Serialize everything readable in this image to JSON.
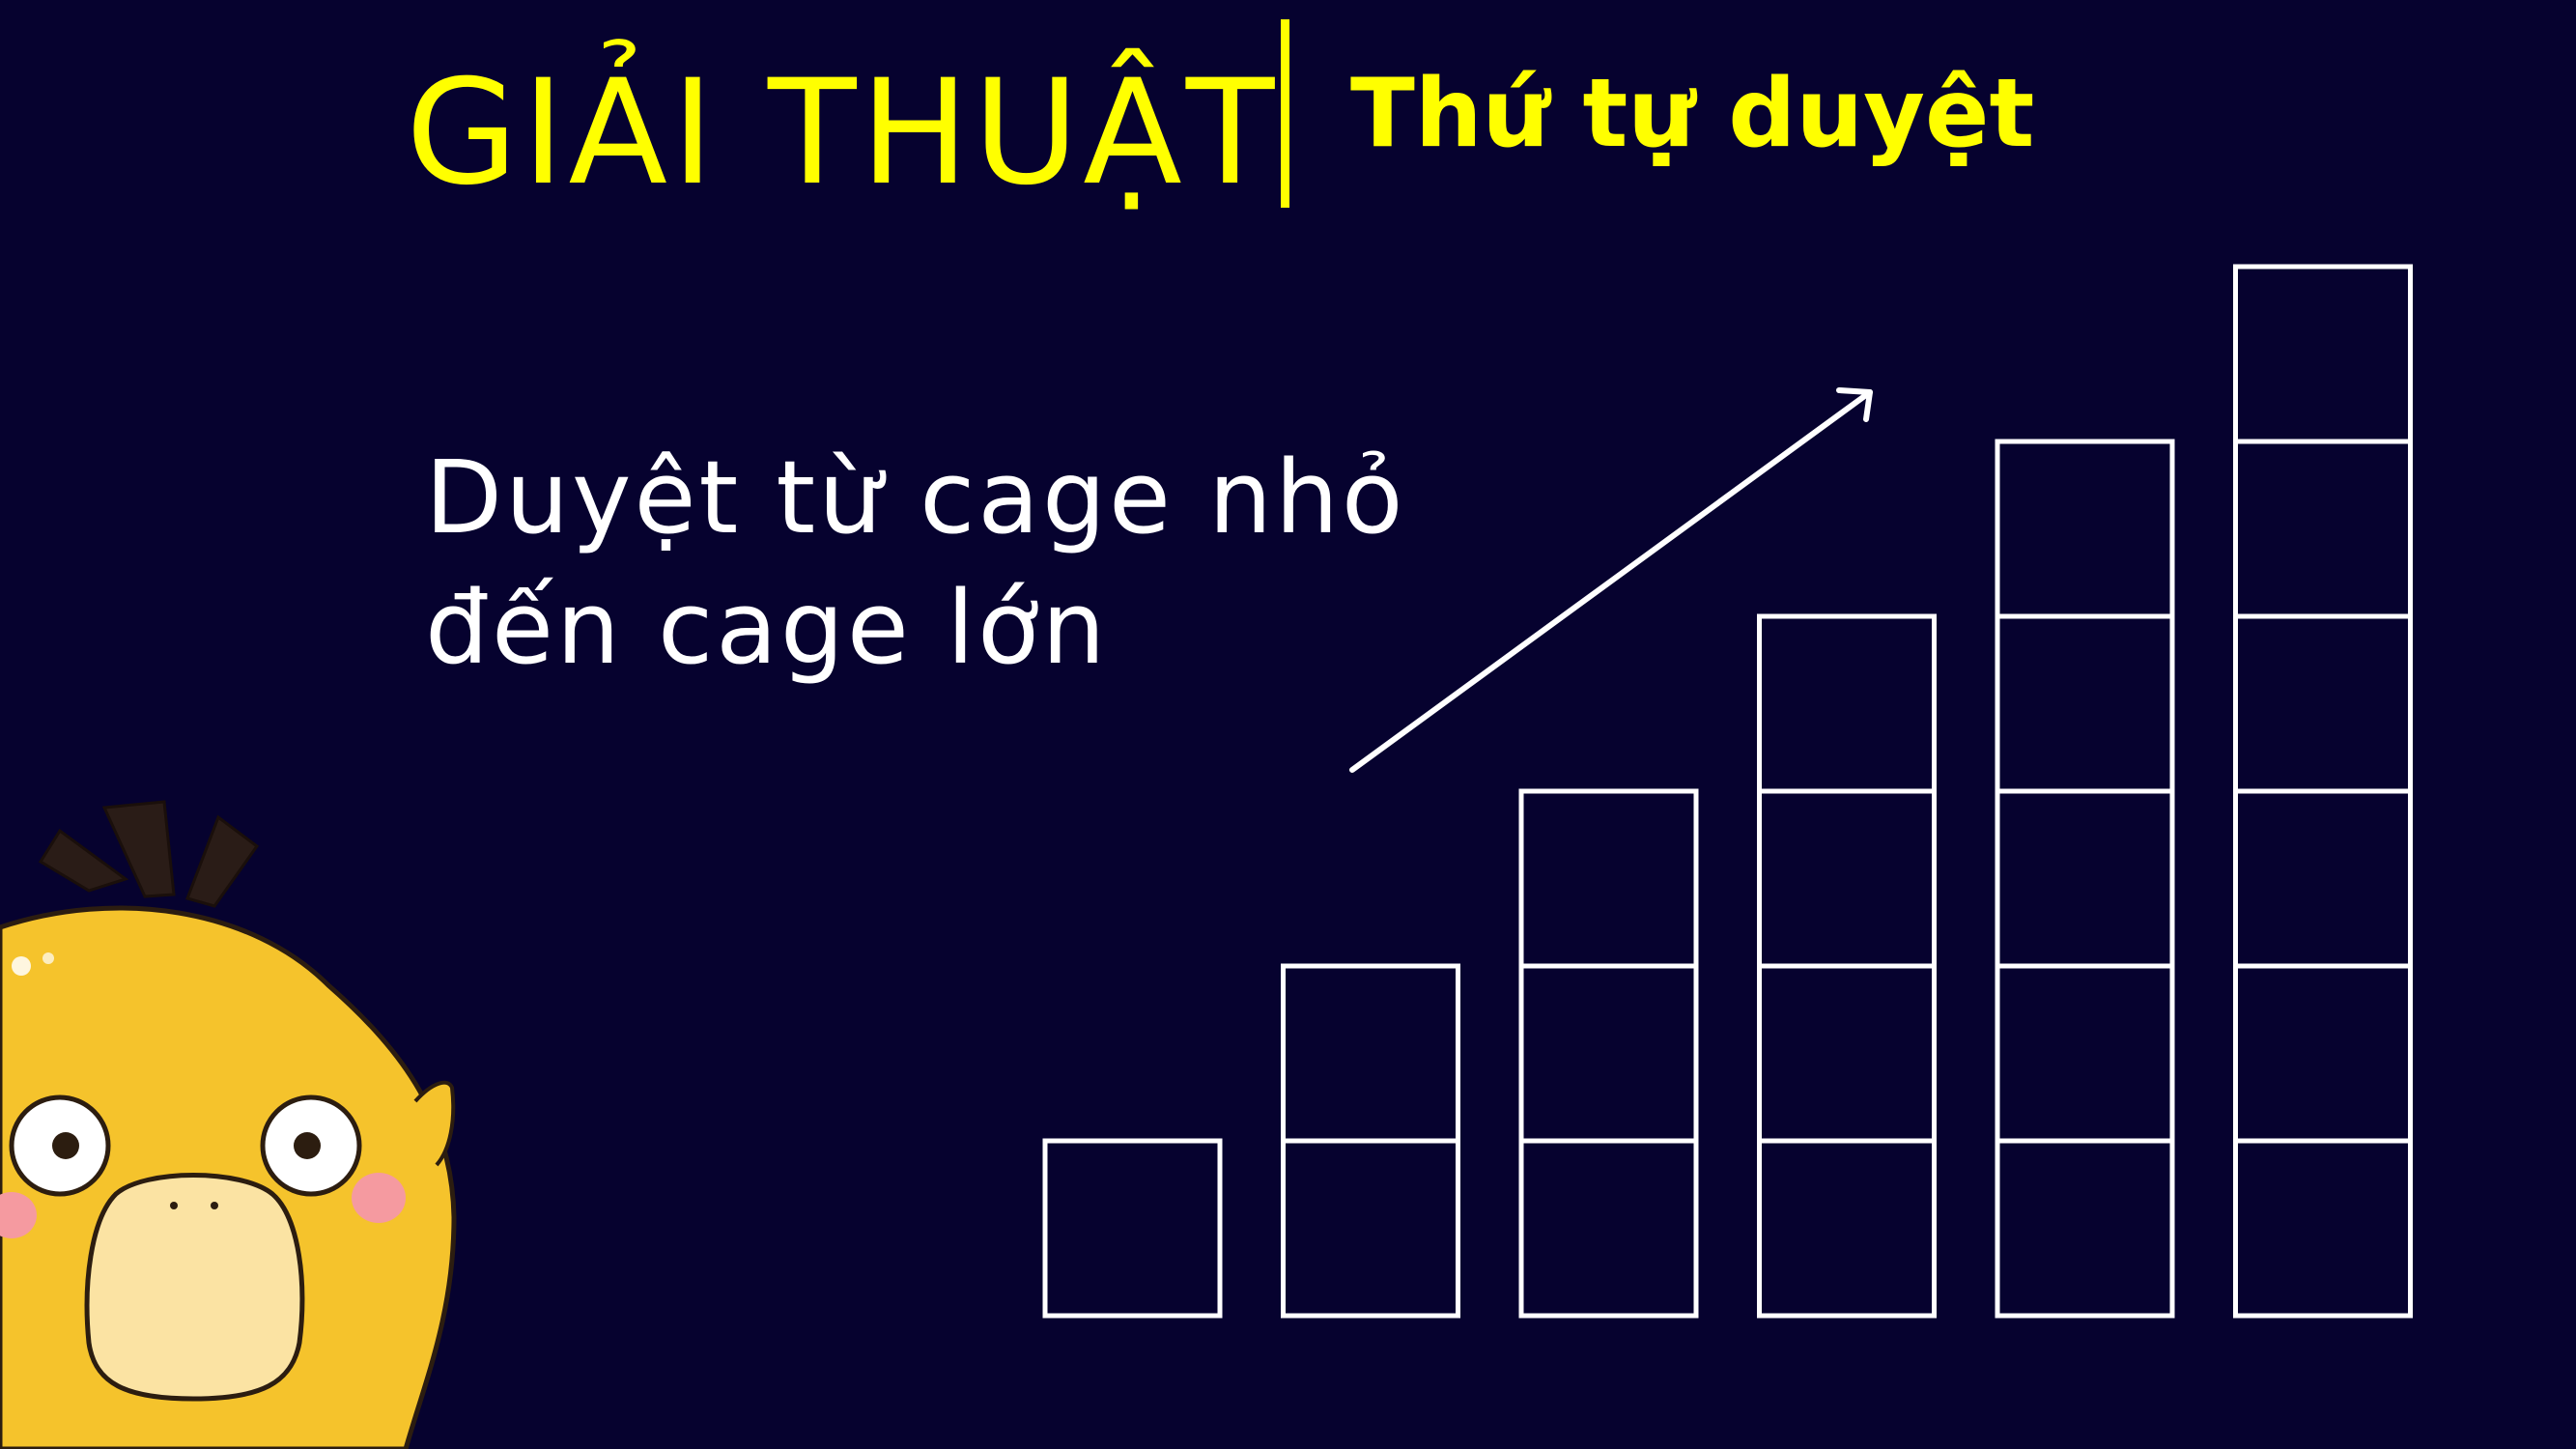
{
  "slide": {
    "title": "GIẢI THUẬT",
    "subtitle": "Thứ tự duyệt",
    "body_line_1": "Duyệt từ cage nhỏ",
    "body_line_2": "đến cage lớn"
  },
  "colors": {
    "background": "#06022f",
    "title": "#ffff00",
    "text": "#ffffff",
    "outline": "#ffffff",
    "mascot_body": "#f5c32c",
    "mascot_beak": "#fbe3a3",
    "mascot_cheek": "#f59aa0"
  },
  "icons": {
    "arrow": "increasing-arrow-icon",
    "mascot": "psyduck-mascot-icon"
  },
  "chart_data": {
    "type": "bar",
    "categories": [
      "",
      "",
      "",
      "",
      "",
      ""
    ],
    "values": [
      1,
      2,
      3,
      4,
      5,
      6
    ],
    "unit_squares": true,
    "ylim": [
      0,
      6
    ],
    "grid": false,
    "legend": "none",
    "trend_arrow": "up-right"
  }
}
